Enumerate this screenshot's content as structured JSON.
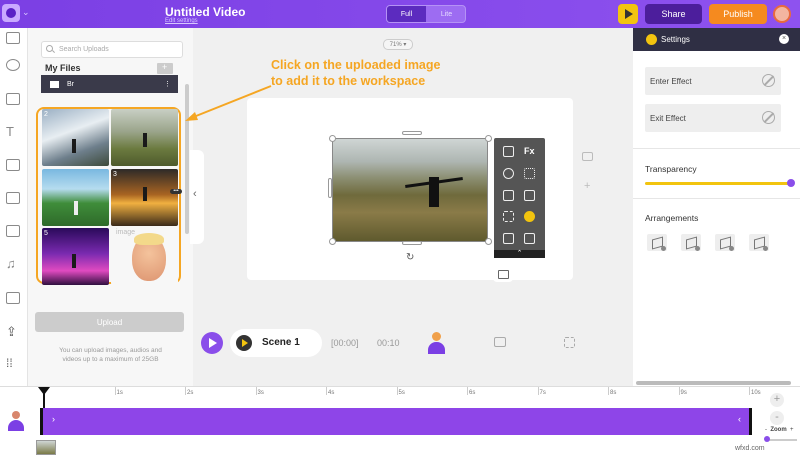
{
  "topbar": {
    "title": "Untitled Video",
    "subtitle": "Edit settings",
    "mode_full": "Full",
    "mode_lite": "Lite",
    "share_label": "Share",
    "publish_label": "Publish"
  },
  "uploads": {
    "search_placeholder": "Search Uploads",
    "my_files_label": "My Files",
    "folder_name": "Br",
    "thumb_numbers": [
      "2",
      "3",
      "5"
    ],
    "image_label": "image",
    "bg_label": "bg",
    "upload_button": "Upload",
    "upload_note": "You can upload images, audios and videos up to a maximum of 25GB"
  },
  "canvas": {
    "zoom_value": "71%",
    "annotation_line1": "Click on the uploaded image",
    "annotation_line2": "to add it to the workspace",
    "fx_label": "Fx"
  },
  "playback": {
    "scene_name": "Scene 1",
    "time_start": "[00:00]",
    "time_end": "00:10"
  },
  "settings": {
    "title": "Settings",
    "enter_effect": "Enter Effect",
    "exit_effect": "Exit Effect",
    "transparency_label": "Transparency",
    "transparency_value": 0.98,
    "arrangements_label": "Arrangements"
  },
  "timeline": {
    "ticks": [
      "1s",
      "2s",
      "3s",
      "4s",
      "5s",
      "6s",
      "7s",
      "8s",
      "9s",
      "10s"
    ],
    "zoom_label": "Zoom",
    "zoom_minus": "-",
    "zoom_plus": "+"
  },
  "watermark": "wfxd.com",
  "colors": {
    "brand_purple": "#7b3fe4",
    "accent_orange": "#f58a1f",
    "accent_yellow": "#f2c40f",
    "annotation_orange": "#f5a623"
  }
}
